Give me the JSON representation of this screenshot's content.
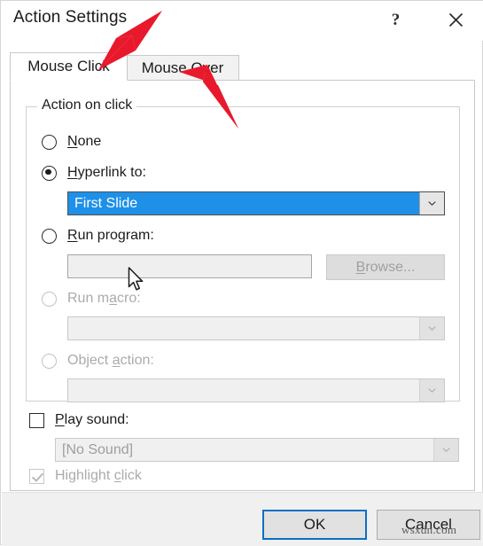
{
  "window": {
    "title": "Action Settings",
    "help_icon": "question-mark-icon",
    "close_icon": "close-x-icon"
  },
  "tabs": [
    {
      "label": "Mouse Click",
      "active": true
    },
    {
      "label": "Mouse Over",
      "active": false
    }
  ],
  "group": {
    "legend": "Action on click"
  },
  "options": [
    {
      "id": "none",
      "label": "None",
      "accel": "N",
      "selected": false,
      "enabled": true
    },
    {
      "id": "hyperlink",
      "label": "Hyperlink to:",
      "accel": "H",
      "selected": true,
      "enabled": true,
      "combo_value": "First Slide",
      "combo_state": "selected"
    },
    {
      "id": "run-program",
      "label": "Run program:",
      "accel": "R",
      "selected": false,
      "enabled": true,
      "input_value": "",
      "browse_label": "Browse...",
      "browse_accel": "B",
      "browse_enabled": false
    },
    {
      "id": "run-macro",
      "label": "Run macro:",
      "accel": "m",
      "selected": false,
      "enabled": false,
      "combo_value": "",
      "combo_state": "disabled"
    },
    {
      "id": "object-action",
      "label": "Object action:",
      "accel": "a",
      "selected": false,
      "enabled": false,
      "combo_value": "",
      "combo_state": "disabled"
    }
  ],
  "play_sound": {
    "label": "Play sound:",
    "accel": "P",
    "checked": false,
    "enabled": true,
    "combo_value": "[No Sound]",
    "combo_state": "disabled"
  },
  "highlight_click": {
    "label": "Highlight click",
    "accel": "c",
    "checked": true,
    "enabled": false
  },
  "footer": {
    "ok_label": "OK",
    "cancel_label": "Cancel"
  },
  "annotations": {
    "arrow_color": "#e8192c",
    "arrow_1_target": "Mouse Click tab",
    "arrow_2_target": "Mouse Over tab"
  },
  "watermark": {
    "text": "wsxdn.com"
  }
}
